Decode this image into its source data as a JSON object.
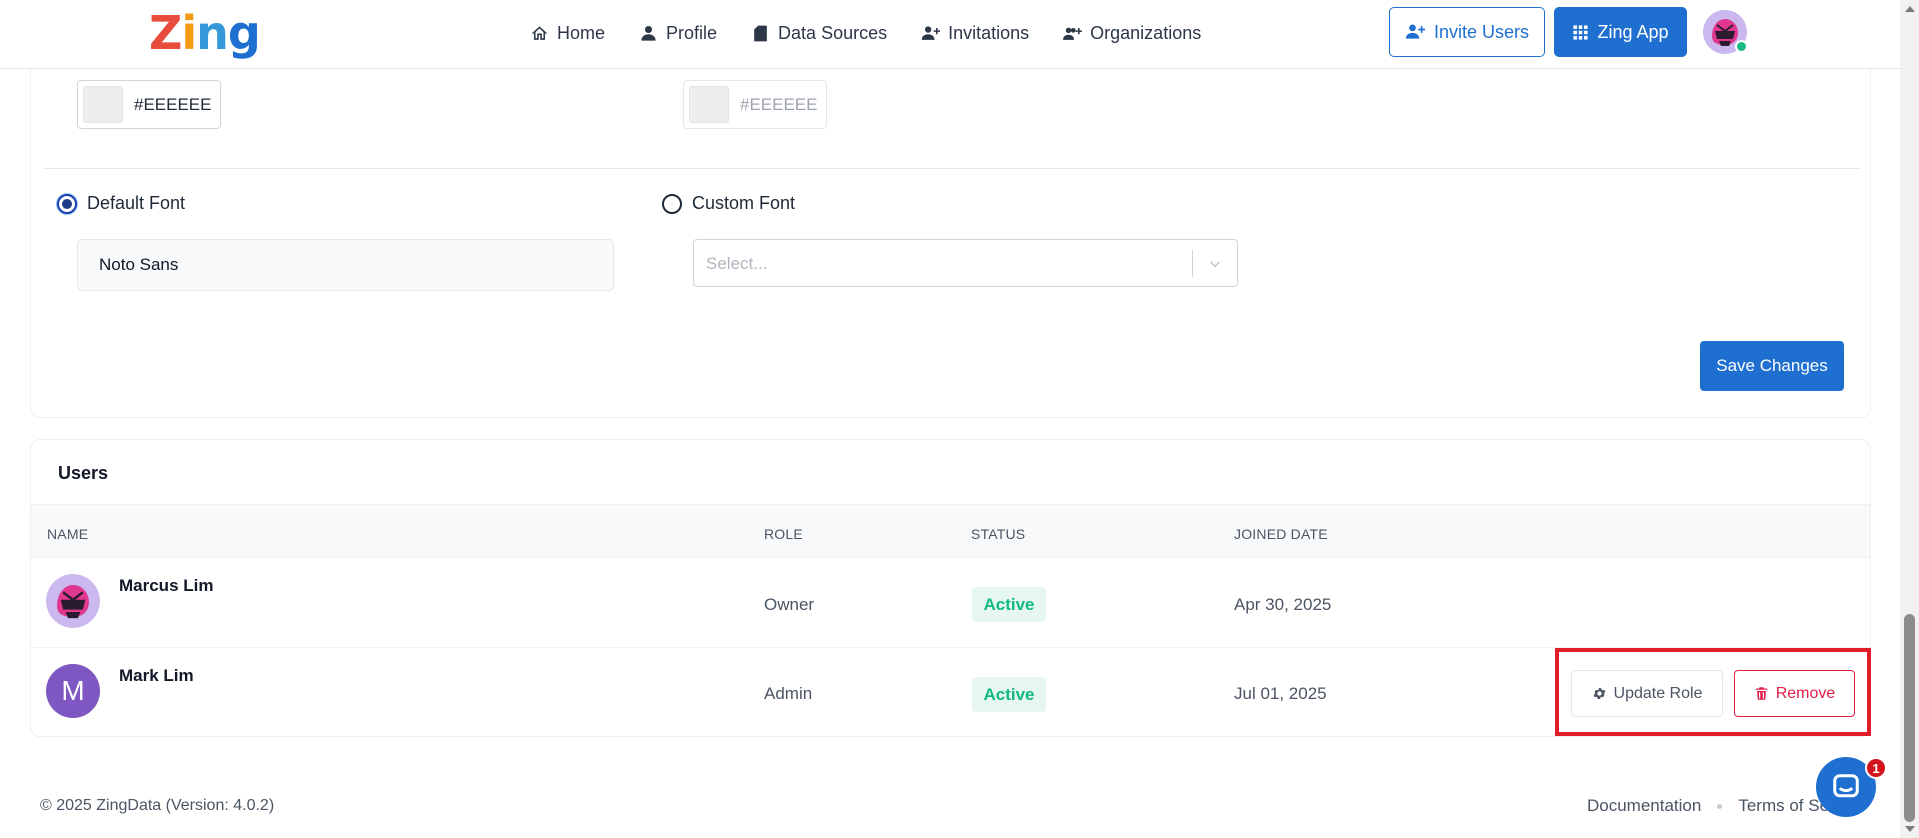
{
  "brand": {
    "name": "Zing",
    "letters": [
      "Z",
      "i",
      "n",
      "g"
    ]
  },
  "nav": {
    "items": [
      {
        "label": "Home",
        "icon": "home-icon"
      },
      {
        "label": "Profile",
        "icon": "user-icon"
      },
      {
        "label": "Data Sources",
        "icon": "file-icon"
      },
      {
        "label": "Invitations",
        "icon": "user-plus-icon"
      },
      {
        "label": "Organizations",
        "icon": "users-plus-icon"
      }
    ],
    "invite_button": "Invite Users",
    "app_button": "Zing App"
  },
  "settings": {
    "color_primary": "#EEEEEE",
    "color_secondary": "#EEEEEE",
    "default_font_label": "Default Font",
    "custom_font_label": "Custom Font",
    "default_font_value": "Noto Sans",
    "custom_font_placeholder": "Select...",
    "save_button": "Save Changes"
  },
  "users": {
    "title": "Users",
    "columns": [
      "NAME",
      "ROLE",
      "STATUS",
      "JOINED DATE"
    ],
    "rows": [
      {
        "name": "Marcus Lim",
        "role": "Owner",
        "status": "Active",
        "joined": "Apr 30, 2025",
        "avatar": "helmet-avatar"
      },
      {
        "name": "Mark Lim",
        "role": "Admin",
        "status": "Active",
        "joined": "Jul 01, 2025",
        "avatar_letter": "M"
      }
    ],
    "update_role_button": "Update Role",
    "remove_button": "Remove"
  },
  "footer": {
    "copyright": "© 2025 ZingData (Version: 4.0.2)",
    "links": [
      "Documentation",
      "Terms of Se"
    ]
  },
  "chat": {
    "unread": "1"
  },
  "colors": {
    "primary": "#1e6fd0",
    "success": "#10b981",
    "danger": "#e11d48",
    "highlight": "#e11d2a"
  }
}
